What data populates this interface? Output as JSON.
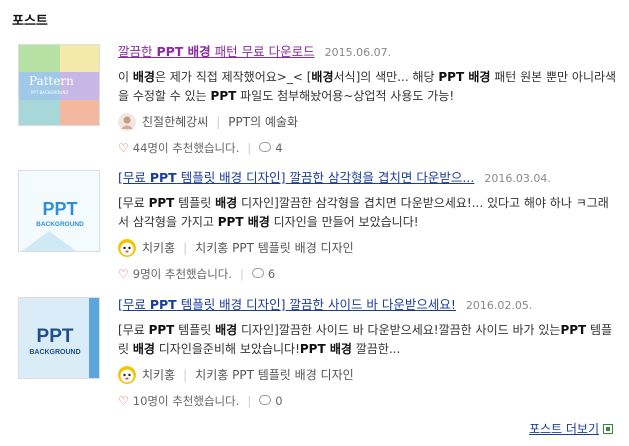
{
  "section": {
    "title": "포스트"
  },
  "posts": [
    {
      "title_pre": "깔끔한 ",
      "title_bold": "PPT 배경",
      "title_post": " 패턴 무료 다운로드",
      "date": "2015.06.07.",
      "summary_html": "이 <b>배경</b>은 제가 직접 제작했어요&gt;_&lt; [<b>배경</b>서식]의 색만... 해당 <b>PPT 배경</b> 패턴 원본 뿐만 아니라색을 수정할 수 있는 <b>PPT</b> 파일도 첨부해놨어용~상업적 사용도 가능!",
      "author": "친절한혜강씨",
      "blog": "PPT의 예술화",
      "likes": "44명이 추천했습니다.",
      "comments": "4",
      "thumb_text": "Pattern",
      "thumb_sub": "PPT BACKGROUND"
    },
    {
      "title_pre": "[무료 ",
      "title_bold": "PPT",
      "title_post": " 템플릿 배경 디자인] 깔끔한 삼각형을 겹치면 다운받으...",
      "date": "2016.03.04.",
      "summary_html": "[무료 <b>PPT</b> 템플릿 <b>배경</b> 디자인]깔끔한 삼각형을 겹치면 다운받으세요!... 있다고 해야 하나 ㅋ그래서 삼각형을 가지고 <b>PPT 배경</b> 디자인을 만들어 보았습니다!",
      "author": "치키홍",
      "blog": "치키홍 PPT 템플릿 배경 디자인",
      "likes": "9명이 추천했습니다.",
      "comments": "6",
      "thumb_text": "PPT",
      "thumb_sub": "BACKGROUND"
    },
    {
      "title_pre": "[무료 ",
      "title_bold": "PPT",
      "title_post": " 템플릿 배경 디자인] 깔끔한 사이드 바 다운받으세요!",
      "date": "2016.02.05.",
      "summary_html": "[무료 <b>PPT</b> 템플릿 <b>배경</b> 디자인]깔끔한 사이드 바 다운받으세요!깔끔한 사이드 바가 있는<b>PPT</b> 템플릿 <b>배경</b> 디자인을준비해 보았습니다!<b>PPT 배경</b> 깔끔한...",
      "author": "치키홍",
      "blog": "치키홍 PPT 템플릿 배경 디자인",
      "likes": "10명이 추천했습니다.",
      "comments": "0",
      "thumb_text": "PPT",
      "thumb_sub": "BACKGROUND"
    }
  ],
  "more": {
    "label": "포스트 더보기"
  },
  "icons": {
    "like": "heart-icon",
    "comment": "comment-icon",
    "more": "external-window-icon"
  },
  "colors": {
    "visited_link": "#8a2ba0",
    "link": "#1a3c9c",
    "heart": "#e04a4a",
    "more_icon": "#2e8b3e"
  }
}
